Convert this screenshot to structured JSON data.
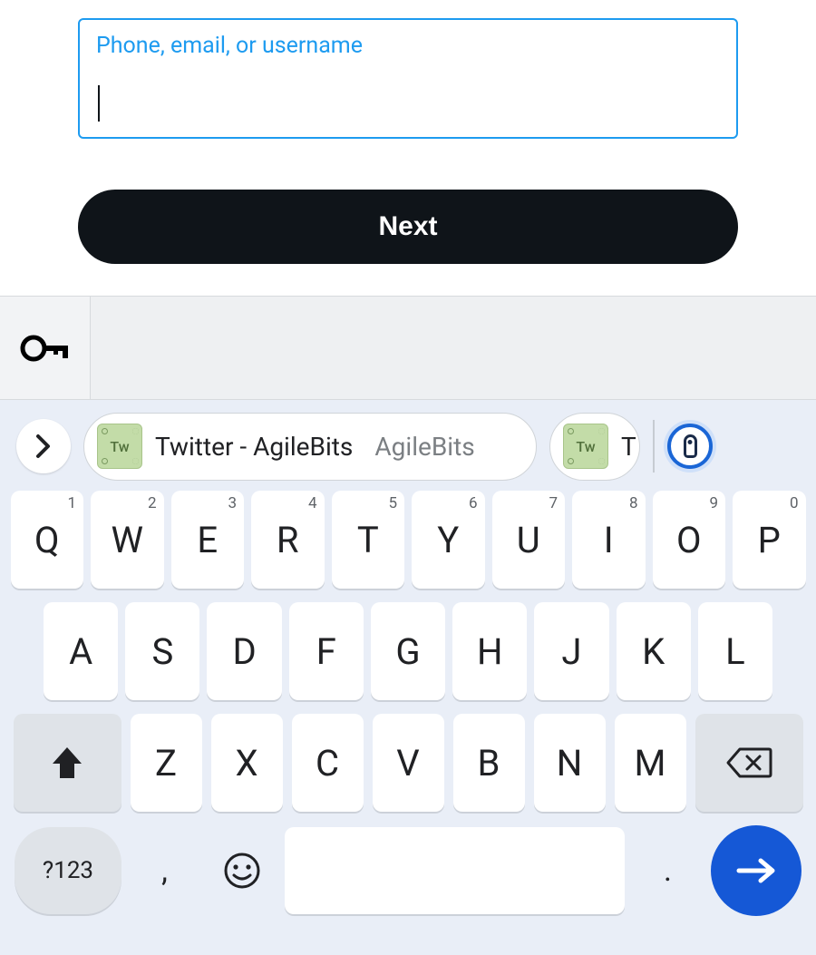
{
  "login": {
    "input_label": "Phone, email, or username",
    "input_value": "",
    "next_label": "Next"
  },
  "suggestions": {
    "primary_title": "Twitter - AgileBits",
    "primary_sub": "AgileBits",
    "secondary_title_partial": "T",
    "tile_text": "Tw"
  },
  "keyboard": {
    "row1": [
      {
        "k": "Q",
        "n": "1"
      },
      {
        "k": "W",
        "n": "2"
      },
      {
        "k": "E",
        "n": "3"
      },
      {
        "k": "R",
        "n": "4"
      },
      {
        "k": "T",
        "n": "5"
      },
      {
        "k": "Y",
        "n": "6"
      },
      {
        "k": "U",
        "n": "7"
      },
      {
        "k": "I",
        "n": "8"
      },
      {
        "k": "O",
        "n": "9"
      },
      {
        "k": "P",
        "n": "0"
      }
    ],
    "row2": [
      "A",
      "S",
      "D",
      "F",
      "G",
      "H",
      "J",
      "K",
      "L"
    ],
    "row3": [
      "Z",
      "X",
      "C",
      "V",
      "B",
      "N",
      "M"
    ],
    "sym_label": "?123",
    "comma": ",",
    "period": "."
  }
}
